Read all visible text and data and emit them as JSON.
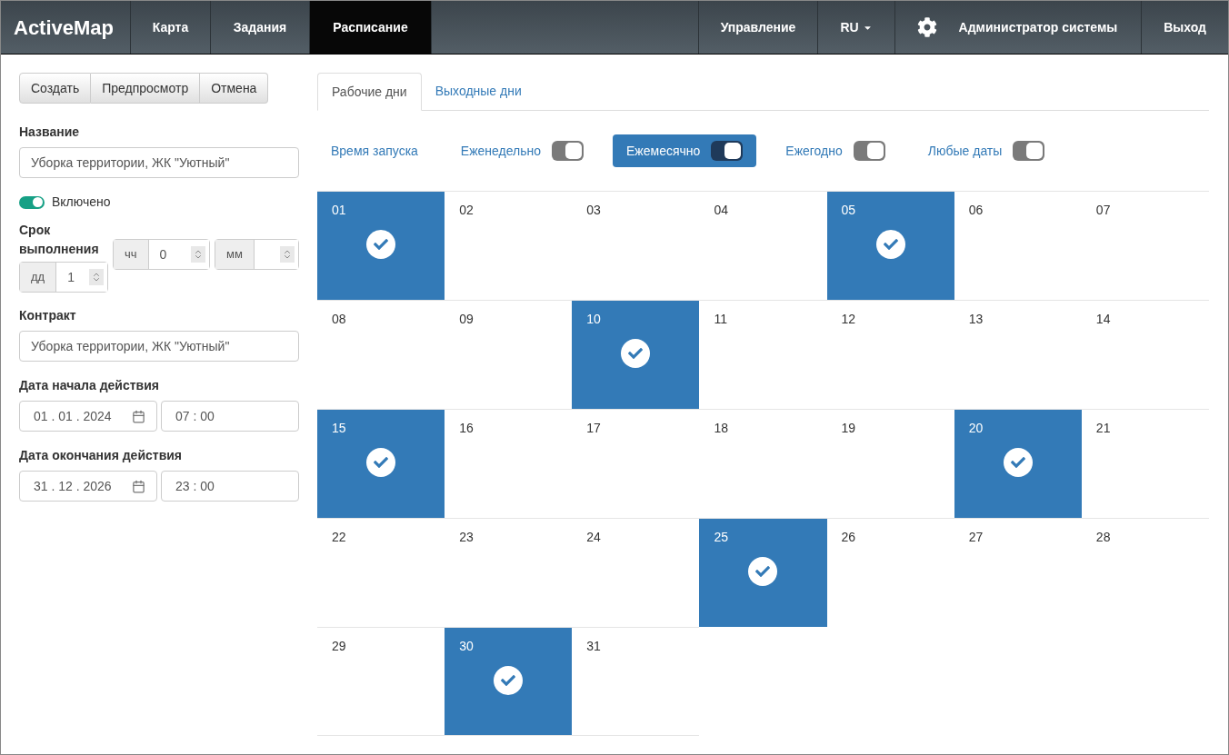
{
  "navbar": {
    "brand": "ActiveMap",
    "items": [
      {
        "label": "Карта",
        "selected": false
      },
      {
        "label": "Задания",
        "selected": false
      },
      {
        "label": "Расписание",
        "selected": true
      }
    ],
    "right": [
      {
        "kind": "link",
        "label": "Управление"
      },
      {
        "kind": "dropdown",
        "label": "RU"
      },
      {
        "kind": "user",
        "label": "Администратор системы"
      },
      {
        "kind": "link",
        "label": "Выход"
      }
    ]
  },
  "toolbar": [
    "Создать",
    "Предпросмотр",
    "Отмена"
  ],
  "form": {
    "name_label": "Название",
    "name_value": "Уборка территории, ЖК \"Уютный\"",
    "enabled": {
      "label": "Включено",
      "on": true
    },
    "duration_label": "Срок выполнения",
    "duration": [
      {
        "unit": "чч",
        "value": "0"
      },
      {
        "unit": "мм"
      },
      {
        "unit": "дд",
        "value": "1"
      }
    ],
    "contract_label": "Контракт",
    "contract_value": "Уборка территории, ЖК \"Уютный\"",
    "start_label": "Дата начала действия",
    "start_date": "01 . 01 . 2024",
    "start_time": "07 : 00",
    "end_label": "Дата окончания действия",
    "end_date": "31 . 12 . 2026",
    "end_time": "23 : 00"
  },
  "tabs": [
    {
      "label": "Рабочие дни",
      "selected": true
    },
    {
      "label": "Выходные дни",
      "selected": false
    }
  ],
  "modes": [
    {
      "label": "Время запуска",
      "kind": "plain",
      "selected": false
    },
    {
      "label": "Еженедельно",
      "kind": "toggle",
      "selected": false
    },
    {
      "label": "Ежемесячно",
      "kind": "toggle",
      "selected": true
    },
    {
      "label": "Ежегодно",
      "kind": "toggle",
      "selected": false
    },
    {
      "label": "Любые даты",
      "kind": "toggle",
      "selected": false
    }
  ],
  "days": [
    {
      "label": "01",
      "checked": true
    },
    {
      "label": "02",
      "checked": false
    },
    {
      "label": "03",
      "checked": false
    },
    {
      "label": "04",
      "checked": false
    },
    {
      "label": "05",
      "checked": true
    },
    {
      "label": "06",
      "checked": false
    },
    {
      "label": "07",
      "checked": false
    },
    {
      "label": "08",
      "checked": false
    },
    {
      "label": "09",
      "checked": false
    },
    {
      "label": "10",
      "checked": true
    },
    {
      "label": "11",
      "checked": false
    },
    {
      "label": "12",
      "checked": false
    },
    {
      "label": "13",
      "checked": false
    },
    {
      "label": "14",
      "checked": false
    },
    {
      "label": "15",
      "checked": true
    },
    {
      "label": "16",
      "checked": false
    },
    {
      "label": "17",
      "checked": false
    },
    {
      "label": "18",
      "checked": false
    },
    {
      "label": "19",
      "checked": false
    },
    {
      "label": "20",
      "checked": true
    },
    {
      "label": "21",
      "checked": false
    },
    {
      "label": "22",
      "checked": false
    },
    {
      "label": "23",
      "checked": false
    },
    {
      "label": "24",
      "checked": false
    },
    {
      "label": "25",
      "checked": true
    },
    {
      "label": "26",
      "checked": false
    },
    {
      "label": "27",
      "checked": false
    },
    {
      "label": "28",
      "checked": false
    },
    {
      "label": "29",
      "checked": false
    },
    {
      "label": "30",
      "checked": true
    },
    {
      "label": "31",
      "checked": false
    }
  ]
}
